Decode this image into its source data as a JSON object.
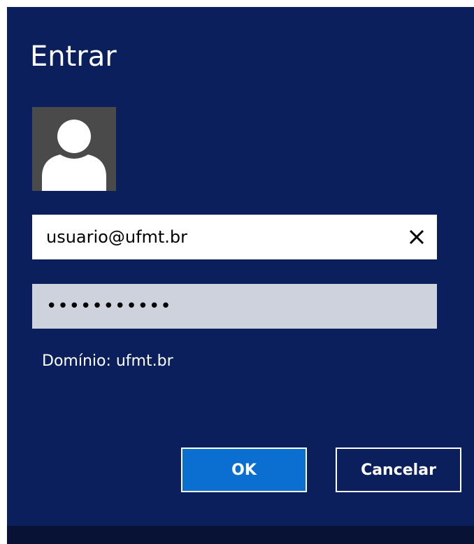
{
  "dialog": {
    "title": "Entrar",
    "background_color": "#0a1f5c",
    "avatar": {
      "icon": "user-avatar-icon",
      "background_color": "#4a4a4a"
    },
    "username_field": {
      "value": "usuario@ufmt.br",
      "clear_icon": "close-icon"
    },
    "password_field": {
      "value": "•••••••••••"
    },
    "domain_label": "Domínio: ufmt.br",
    "buttons": {
      "ok_label": "OK",
      "cancel_label": "Cancelar"
    },
    "accent_color": "#0a6fd0"
  }
}
